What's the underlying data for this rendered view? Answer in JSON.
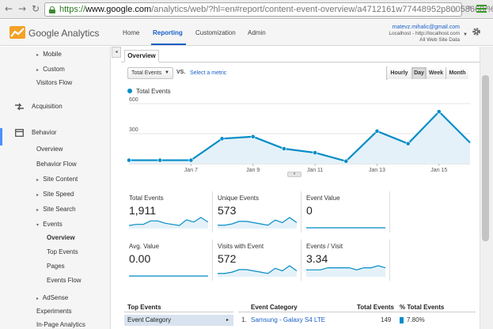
{
  "browser": {
    "url_scheme": "https://",
    "url_host": "www.google.com",
    "url_path": "/analytics/web/?hl=en#report/content-event-overview/a4712161w77448952p80058660/%...",
    "icons": [
      "back-arrow-icon",
      "forward-arrow-icon",
      "reload-icon",
      "lock-icon",
      "star-icon",
      "menu-icon"
    ],
    "ext_label": "»"
  },
  "header": {
    "product": "Google Analytics",
    "nav": [
      "Home",
      "Reporting",
      "Customization",
      "Admin"
    ],
    "active_nav": "Reporting",
    "account_email": "matevz.mihalic@gmail.com",
    "account_property": "Localhost - http://localhost.com",
    "account_view": "All Web Site Data",
    "accent": "#1a5fc7"
  },
  "sidebar": {
    "items": [
      {
        "label": "Mobile",
        "caret": "▸"
      },
      {
        "label": "Custom",
        "caret": "▸"
      },
      {
        "label": "Visitors Flow",
        "caret": ""
      },
      {
        "label": "Acquisition",
        "caret": ""
      },
      {
        "label": "Behavior",
        "caret": ""
      },
      {
        "label": "Overview",
        "caret": ""
      },
      {
        "label": "Behavior Flow",
        "caret": ""
      },
      {
        "label": "Site Content",
        "caret": "▸"
      },
      {
        "label": "Site Speed",
        "caret": "▸"
      },
      {
        "label": "Site Search",
        "caret": "▸"
      },
      {
        "label": "Events",
        "caret": "▾"
      },
      {
        "label": "Overview",
        "caret": ""
      },
      {
        "label": "Top Events",
        "caret": ""
      },
      {
        "label": "Pages",
        "caret": ""
      },
      {
        "label": "Events Flow",
        "caret": ""
      },
      {
        "label": "AdSense",
        "caret": "▸"
      },
      {
        "label": "Experiments",
        "caret": ""
      },
      {
        "label": "In-Page Analytics",
        "caret": ""
      }
    ],
    "collapse_glyph": "◂"
  },
  "report": {
    "tab": "Overview",
    "metric_select": "Total Events",
    "vs": "VS.",
    "select_metric": "Select a metric",
    "periods": [
      "Hourly",
      "Day",
      "Week",
      "Month"
    ],
    "active_period": "Day",
    "drag_glyph": "▾"
  },
  "chart_data": {
    "type": "area",
    "series": [
      {
        "name": "Total Events",
        "values": [
          35,
          35,
          35,
          250,
          270,
          150,
          110,
          25,
          325,
          200,
          520,
          210
        ]
      }
    ],
    "x": [
      "Jan 5",
      "Jan 6",
      "Jan 7",
      "Jan 8",
      "Jan 9",
      "Jan 10",
      "Jan 11",
      "Jan 12",
      "Jan 13",
      "Jan 14",
      "Jan 15",
      "Jan 16"
    ],
    "xtick_labels": [
      "Jan 7",
      "Jan 9",
      "Jan 11",
      "Jan 13",
      "Jan 15"
    ],
    "ytick_labels": [
      "600",
      "300"
    ],
    "ylim": [
      0,
      600
    ],
    "color": "#058dc7",
    "fill": "#e4f1f9"
  },
  "scorecards": [
    {
      "label": "Total Events",
      "value": "1,911",
      "spark": [
        2,
        3,
        3,
        6,
        6,
        4,
        3,
        2,
        7,
        5,
        9,
        5
      ]
    },
    {
      "label": "Unique Events",
      "value": "573",
      "spark": [
        2,
        2,
        3,
        5,
        5,
        4,
        3,
        2,
        6,
        4,
        8,
        4
      ]
    },
    {
      "label": "Event Value",
      "value": "0",
      "spark": [
        0,
        0,
        0,
        0,
        0,
        0,
        0,
        0,
        0,
        0,
        0,
        0
      ]
    },
    {
      "label": "Avg. Value",
      "value": "0.00",
      "spark": [
        0,
        0,
        0,
        0,
        0,
        0,
        0,
        0,
        0,
        0,
        0,
        0
      ]
    },
    {
      "label": "Visits with Event",
      "value": "572",
      "spark": [
        2,
        2,
        3,
        5,
        5,
        4,
        3,
        2,
        6,
        4,
        8,
        4
      ]
    },
    {
      "label": "Events / Visit",
      "value": "3.34",
      "spark": [
        3,
        3,
        3,
        4,
        4,
        4,
        4,
        3,
        4,
        4,
        5,
        4
      ]
    }
  ],
  "bottom": {
    "top_events_title": "Top Events",
    "top_events_row": "Event Category",
    "row_arrow": "▸",
    "headers": {
      "category": "Event Category",
      "total": "Total Events",
      "pct": "% Total Events"
    },
    "rows": [
      {
        "index": "1.",
        "category": "Samsung - Galaxy S4 LTE",
        "total": "149",
        "pct": "7.80%"
      }
    ]
  }
}
